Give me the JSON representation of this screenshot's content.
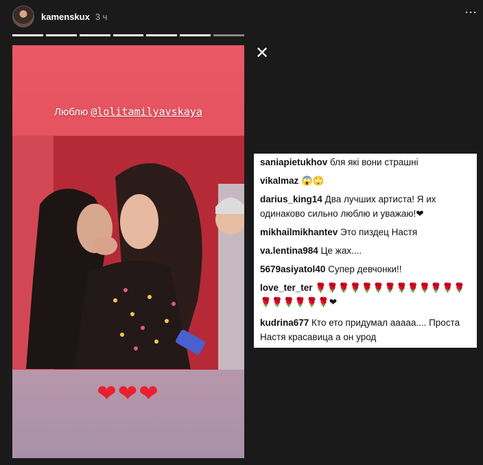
{
  "header": {
    "username": "kamenskux",
    "time": "3 ч",
    "more_icon": "⋯"
  },
  "story": {
    "caption_text": "Люблю ",
    "caption_mention": "@lolitamilyavskaya",
    "hearts": "❤❤❤"
  },
  "close_icon": "✕",
  "comments": [
    {
      "user": "saniapietukhov",
      "text": " бля які вони страшні"
    },
    {
      "user": "vikalmaz",
      "text": " 😱🙄"
    },
    {
      "user": "darius_king14",
      "text": " Два лучших артиста! Я их одинаково сильно люблю и уважаю!❤"
    },
    {
      "user": "mikhailmikhantev",
      "text": " Это пиздец Настя"
    },
    {
      "user": "va.lentina984",
      "text": " Це жах...."
    },
    {
      "user": "5679asiyatol40",
      "text": " Супер девчонки!!"
    },
    {
      "user": "love_ter_ter",
      "text": " 🌹🌹🌹🌹🌹🌹🌹🌹🌹🌹🌹🌹🌹🌹🌹🌹🌹🌹🌹❤"
    },
    {
      "user": "kudrina677",
      "text": " Кто ето придумал ааааа.... Проста Настя красавица а он урод"
    }
  ]
}
